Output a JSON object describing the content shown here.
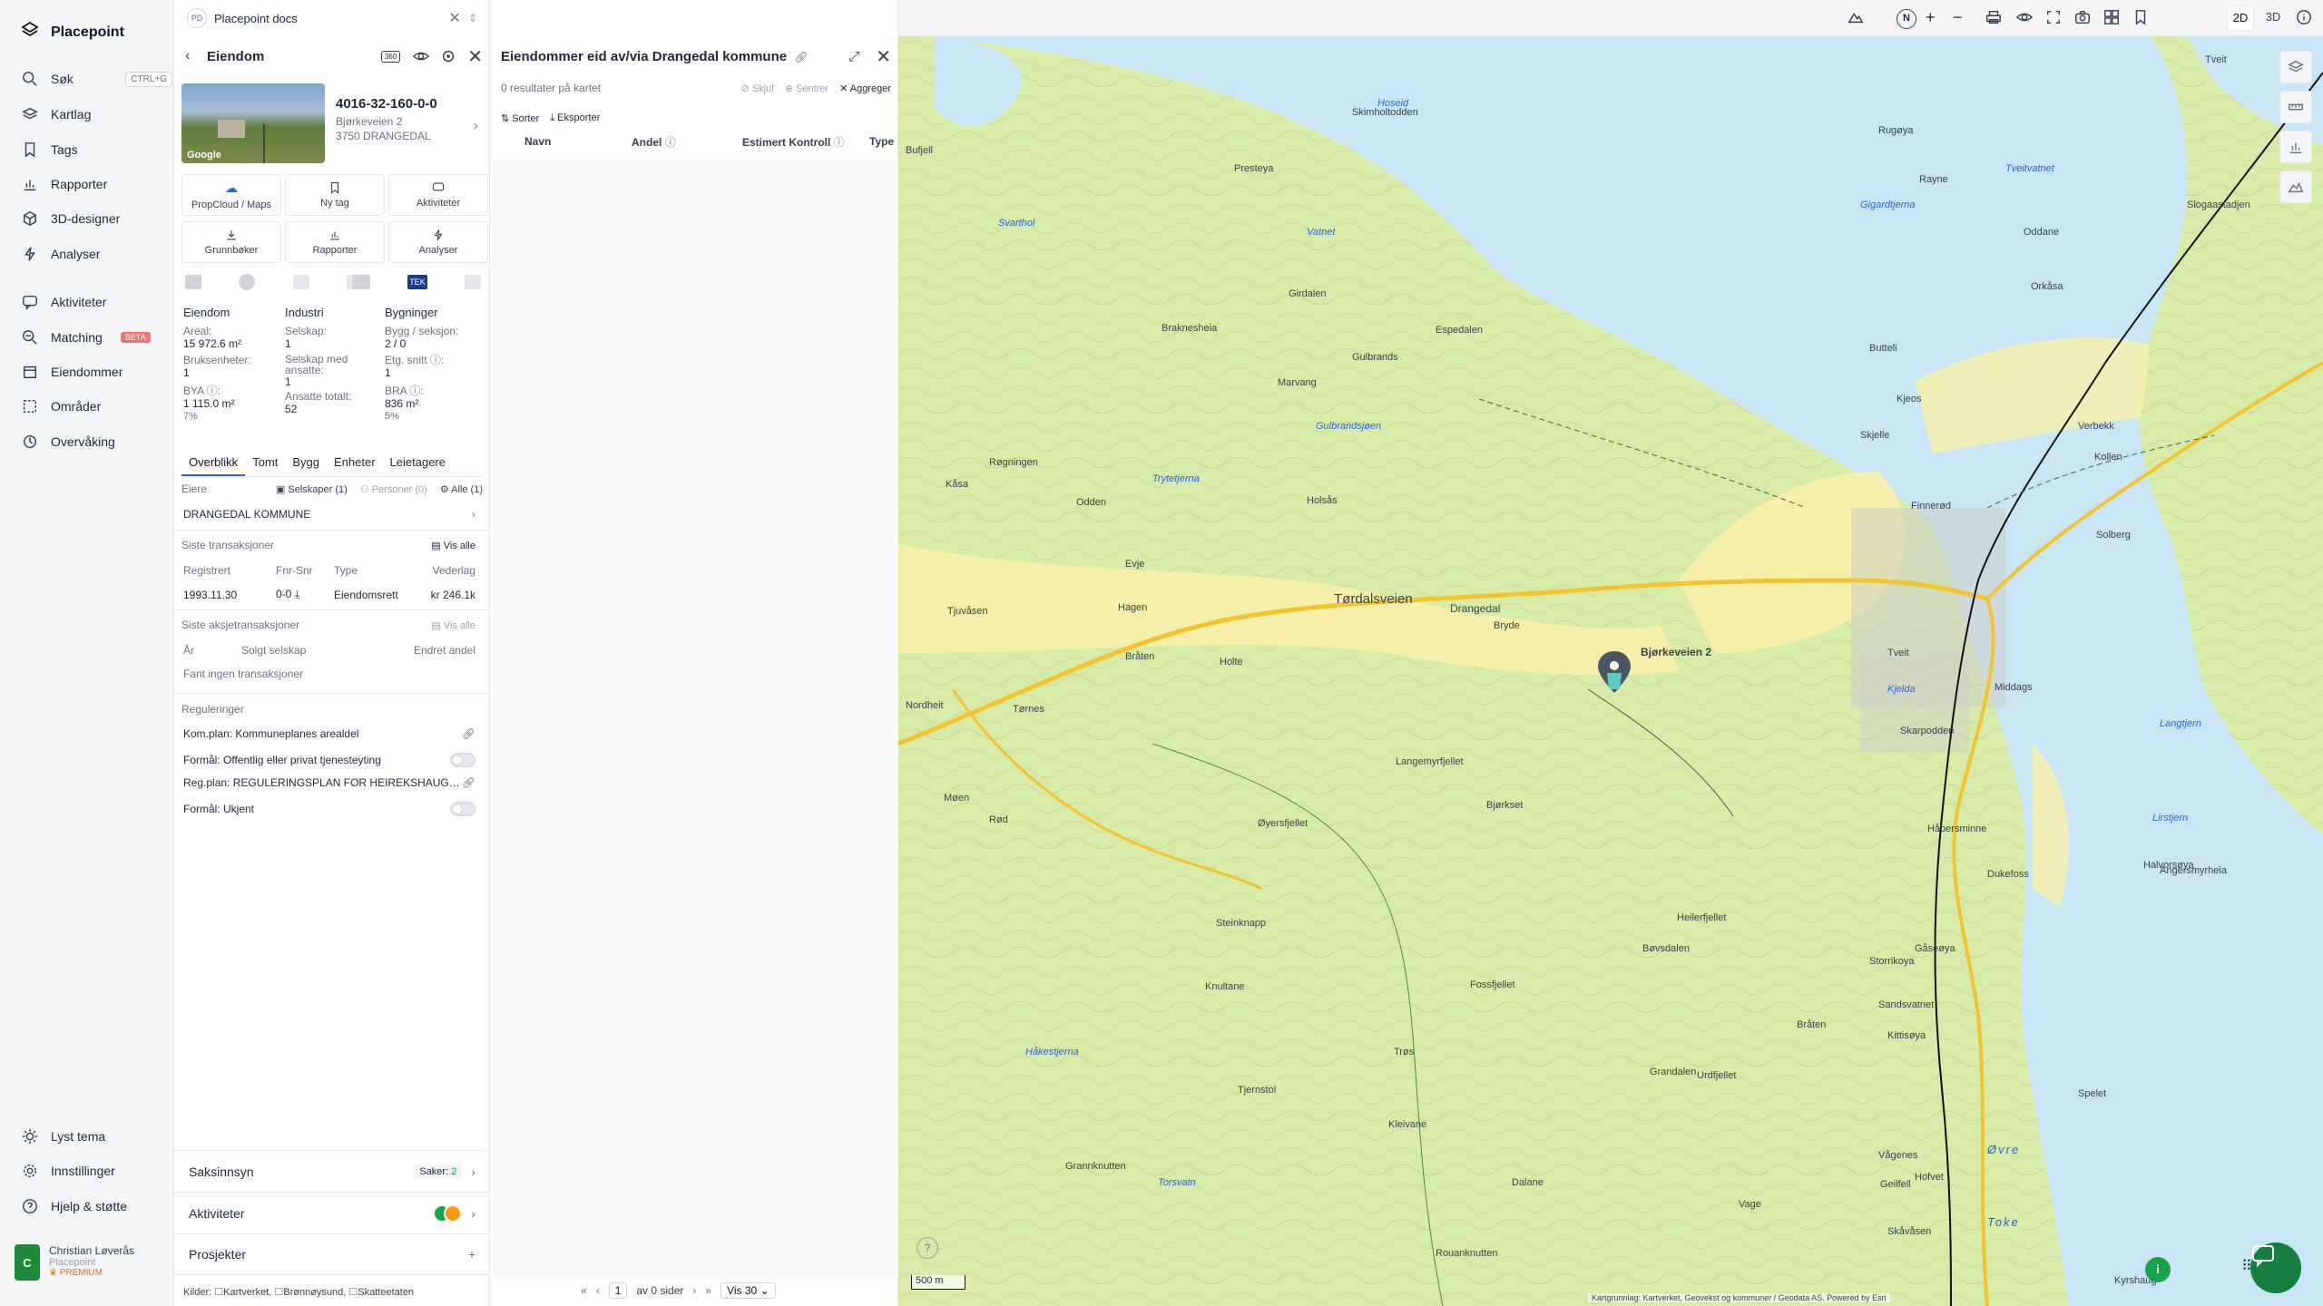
{
  "app": {
    "name": "Placepoint",
    "tab_title": "Placepoint docs"
  },
  "nav": {
    "items": [
      {
        "label": "Søk",
        "shortcut": "CTRL+G",
        "icon": "search-icon"
      },
      {
        "label": "Kartlag",
        "icon": "layers-icon"
      },
      {
        "label": "Tags",
        "icon": "bookmark-icon"
      },
      {
        "label": "Rapporter",
        "icon": "chart-icon"
      },
      {
        "label": "3D-designer",
        "icon": "cube-icon"
      },
      {
        "label": "Analyser",
        "icon": "bolt-icon"
      },
      {
        "label": "Aktiviteter",
        "icon": "chat-icon"
      },
      {
        "label": "Matching",
        "badge": "BETA",
        "icon": "match-icon"
      },
      {
        "label": "Eiendommer",
        "icon": "building-icon"
      },
      {
        "label": "Områder",
        "icon": "area-icon"
      },
      {
        "label": "Overvåking",
        "icon": "monitor-icon"
      }
    ],
    "bottom": [
      {
        "label": "Lyst tema",
        "icon": "sun-icon"
      },
      {
        "label": "Innstillinger",
        "icon": "gear-icon"
      },
      {
        "label": "Hjelp & støtte",
        "icon": "help-icon"
      }
    ],
    "user": {
      "initial": "C",
      "name": "Christian Løverås",
      "org": "Placepoint",
      "tier": "PREMIUM"
    }
  },
  "property": {
    "header": "Eiendom",
    "id": "4016-32-160-0-0",
    "address": "Bjørkeveien 2",
    "postal": "3750 DRANGEDAL",
    "image_credit": "Google",
    "icon_360": "360",
    "actions": [
      "PropCloud / Maps",
      "Ny tag",
      "Aktiviteter",
      "Grunnbøker",
      "Rapporter",
      "Analyser"
    ],
    "tek_label": "TEK",
    "stats": {
      "col1": {
        "head": "Eiendom",
        "areal_label": "Areal:",
        "areal": "15 972.6 m²",
        "bruk_label": "Bruksenheter:",
        "bruk": "1",
        "bya_label": "BYA ⓘ:",
        "bya": "1 115.0 m²",
        "bya_pct": "7%"
      },
      "col2": {
        "head": "Industri",
        "selskap_label": "Selskap:",
        "selskap": "1",
        "ansatte_label": "Selskap med ansatte:",
        "ansatte": "1",
        "tot_label": "Ansatte totalt:",
        "tot": "52"
      },
      "col3": {
        "head": "Bygninger",
        "bygg_label": "Bygg / seksjon:",
        "bygg": "2 / 0",
        "etg_label": "Etg. snitt ⓘ:",
        "etg": "1",
        "bra_label": "BRA ⓘ:",
        "bra": "836 m²",
        "bra_pct": "5%"
      }
    },
    "tabs": [
      "Overblikk",
      "Tomt",
      "Bygg",
      "Enheter",
      "Leietagere"
    ],
    "owners": {
      "label": "Eiere",
      "companies": "Selskaper (1)",
      "persons": "Personer (0)",
      "all": "Alle (1)",
      "owner": "DRANGEDAL KOMMUNE"
    },
    "transactions": {
      "title": "Siste transaksjoner",
      "view_all": "Vis alle",
      "columns": [
        "Registrert",
        "Fnr-Snr",
        "Type",
        "Vederlag"
      ],
      "rows": [
        [
          "1993.11.30",
          "0-0",
          "Eiendomsrett",
          "kr 246.1k"
        ]
      ]
    },
    "share_tx": {
      "title": "Siste aksjetransaksjoner",
      "view_all": "Vis alle",
      "columns": [
        "År",
        "Solgt selskap",
        "Endret andel"
      ],
      "empty": "Fant ingen transaksjoner"
    },
    "regulations": {
      "title": "Reguleringer",
      "items": [
        {
          "label": "Kom.plan: Kommuneplanes arealdel",
          "kind": "link"
        },
        {
          "label": "Formål: Offentlig eller privat tjenesteyting",
          "kind": "toggle"
        },
        {
          "label": "Reg.plan: REGULERINGSPLAN FOR HEIREKSHAUG…",
          "kind": "link"
        },
        {
          "label": "Formål: Ukjent",
          "kind": "toggle"
        }
      ]
    },
    "accordions": [
      {
        "label": "Saksinnsyn",
        "meta_label": "Saker:",
        "meta_value": "2"
      },
      {
        "label": "Aktiviteter"
      },
      {
        "label": "Prosjekter"
      }
    ],
    "sources": {
      "label": "Kilder:",
      "items": [
        "Kartverket,",
        "Brønnøysund,",
        "Skatteetaten"
      ]
    }
  },
  "results": {
    "title": "Eiendommer eid av/via Drangedal kommune",
    "count": "0 resultater på kartet",
    "hide": "Skjul",
    "center": "Sentrer",
    "aggregate": "Aggreger",
    "sort": "Sorter",
    "export": "Eksporter",
    "columns": [
      "Navn",
      "Andel",
      "Estimert Kontroll",
      "Type"
    ],
    "pager": {
      "page": "1",
      "of": "av 0 sider",
      "per_page": "Vis 30"
    }
  },
  "map": {
    "toolbar": {
      "mode_2d": "2D",
      "mode_3d": "3D",
      "north": "N"
    },
    "scale": "500 m",
    "attribution": "Kartgrunnlag: Kartverket, Geovekst og kommuner / Geodata AS. Powered by Esri",
    "pin_label": "Bjørkeveien 2",
    "place_labels": [
      "Hoseid",
      "Presteya",
      "Skimholtodden",
      "Rugøya",
      "Rayne",
      "Tveitvatnet",
      "Gigardtjerna",
      "Oddane",
      "Slogaastadjen",
      "Tveit",
      "Svarthol",
      "Vatnet",
      "Braknesheia",
      "Girdalen",
      "Espedalen",
      "Gulbrands",
      "Butteli",
      "Orkåsa",
      "Kjeos",
      "Skjelle",
      "Marvang",
      "Gulbrandsjøen",
      "Verbekk",
      "Kollen",
      "Røgningen",
      "Trytetjerna",
      "Kåsa",
      "Odden",
      "Holsås",
      "Finnerød",
      "Solberg",
      "Evje",
      "Hagen",
      "Tørdalsveien",
      "Drangedal",
      "Tjuvåsen",
      "Bryde",
      "Holte",
      "Tveit",
      "Bråten",
      "Kjelda",
      "Middags",
      "Nordheit",
      "Tørnes",
      "Skarpodden",
      "Langemyrfjellet",
      "Bjørkset",
      "Møen",
      "Rød",
      "Øyersfjellet",
      "Håbersminne",
      "Bufjell",
      "Langtjern",
      "Lirstjern",
      "Halvorsøya",
      "Dukefoss",
      "Angersmyrheia",
      "Steinknapp",
      "Knultane",
      "Heilerfjellet",
      "Bøvsdalen",
      "Fossfjellet",
      "Storrikoya",
      "Sandsvatnet",
      "Gåseøya",
      "Håkestjerna",
      "Trøs",
      "Grandalen",
      "Urdfjellet",
      "Tjernstol",
      "Kleivane",
      "Bråten",
      "Kittisøya",
      "Spelet",
      "Grannknutten",
      "Vågenes",
      "Geilfell",
      "Hofvet",
      "Øvre",
      "Toke",
      "Skåvåsen",
      "Dalane",
      "Vage",
      "Kyrshaug",
      "Rouanknutten",
      "Torsvatn"
    ]
  }
}
